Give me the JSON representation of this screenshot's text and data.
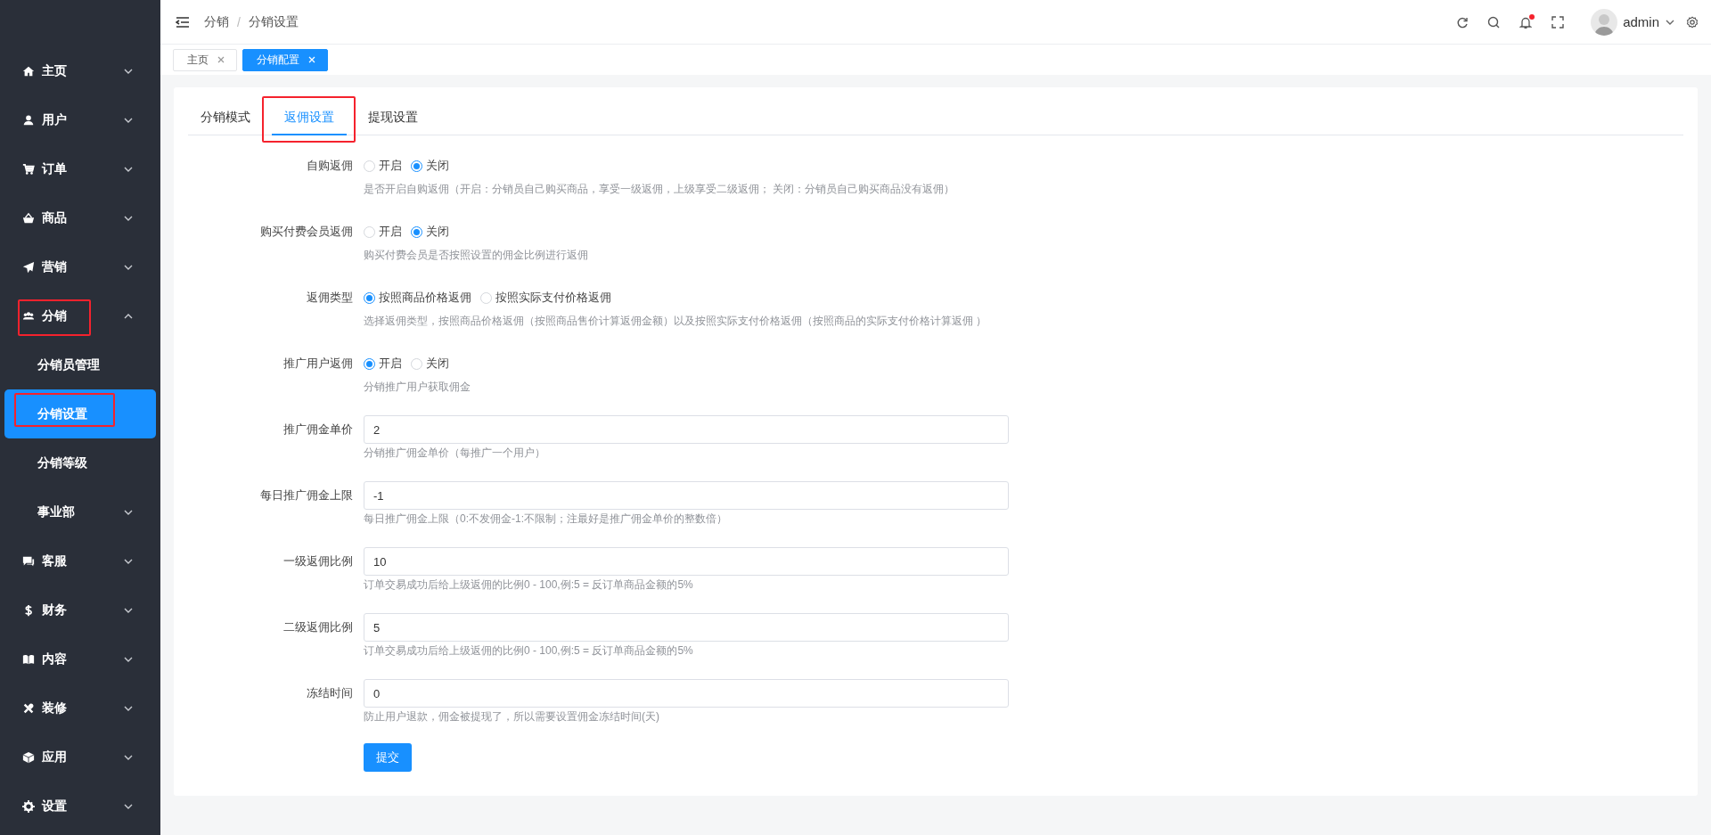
{
  "sidebar": {
    "items": [
      {
        "label": "主页",
        "expanded": false,
        "selected": false,
        "highlighted": false
      },
      {
        "label": "用户",
        "expanded": false,
        "selected": false,
        "highlighted": false
      },
      {
        "label": "订单",
        "expanded": false,
        "selected": false,
        "highlighted": false
      },
      {
        "label": "商品",
        "expanded": false,
        "selected": false,
        "highlighted": false
      },
      {
        "label": "营销",
        "expanded": false,
        "selected": false,
        "highlighted": false
      },
      {
        "label": "分销",
        "expanded": true,
        "selected": false,
        "highlighted": true,
        "children": [
          {
            "label": "分销员管理",
            "selected": false,
            "highlighted": false
          },
          {
            "label": "分销设置",
            "selected": true,
            "highlighted": true
          },
          {
            "label": "分销等级",
            "selected": false,
            "highlighted": false
          },
          {
            "label": "事业部",
            "expanded": false,
            "selected": false,
            "highlighted": false
          }
        ]
      },
      {
        "label": "客服",
        "expanded": false,
        "selected": false,
        "highlighted": false
      },
      {
        "label": "财务",
        "expanded": false,
        "selected": false,
        "highlighted": false
      },
      {
        "label": "内容",
        "expanded": false,
        "selected": false,
        "highlighted": false
      },
      {
        "label": "装修",
        "expanded": false,
        "selected": false,
        "highlighted": false
      },
      {
        "label": "应用",
        "expanded": false,
        "selected": false,
        "highlighted": false
      },
      {
        "label": "设置",
        "expanded": false,
        "selected": false,
        "highlighted": false
      }
    ]
  },
  "header": {
    "breadcrumb": [
      "分销",
      "分销设置"
    ],
    "breadcrumb_separator": "/",
    "has_notification": true,
    "user": "admin"
  },
  "tags": [
    {
      "label": "主页",
      "selected": false
    },
    {
      "label": "分销配置",
      "selected": true
    }
  ],
  "tabs": [
    {
      "label": "分销模式",
      "selected": false,
      "highlighted": false
    },
    {
      "label": "返佣设置",
      "selected": true,
      "highlighted": true
    },
    {
      "label": "提现设置",
      "selected": false,
      "highlighted": false
    }
  ],
  "form": [
    {
      "kind": "radio",
      "label": "自购返佣",
      "options": [
        {
          "label": "开启",
          "selected": false
        },
        {
          "label": "关闭",
          "selected": true
        }
      ],
      "help": "是否开启自购返佣（开启：分销员自己购买商品，享受一级返佣，上级享受二级返佣； 关闭：分销员自己购买商品没有返佣）"
    },
    {
      "kind": "radio",
      "label": "购买付费会员返佣",
      "options": [
        {
          "label": "开启",
          "selected": false
        },
        {
          "label": "关闭",
          "selected": true
        }
      ],
      "help": "购买付费会员是否按照设置的佣金比例进行返佣"
    },
    {
      "kind": "radio",
      "label": "返佣类型",
      "options": [
        {
          "label": "按照商品价格返佣",
          "selected": true
        },
        {
          "label": "按照实际支付价格返佣",
          "selected": false
        }
      ],
      "help": "选择返佣类型，按照商品价格返佣（按照商品售价计算返佣金额）以及按照实际支付价格返佣（按照商品的实际支付价格计算返佣 ）"
    },
    {
      "kind": "radio",
      "label": "推广用户返佣",
      "options": [
        {
          "label": "开启",
          "selected": true
        },
        {
          "label": "关闭",
          "selected": false
        }
      ],
      "help": "分销推广用户获取佣金"
    },
    {
      "kind": "input",
      "label": "推广佣金单价",
      "value": "2",
      "help": "分销推广佣金单价（每推广一个用户）"
    },
    {
      "kind": "input",
      "label": "每日推广佣金上限",
      "value": "-1",
      "help": "每日推广佣金上限（0:不发佣金-1:不限制；注最好是推广佣金单价的整数倍）"
    },
    {
      "kind": "input",
      "label": "一级返佣比例",
      "value": "10",
      "help": "订单交易成功后给上级返佣的比例0 - 100,例:5 = 反订单商品金额的5%"
    },
    {
      "kind": "input",
      "label": "二级返佣比例",
      "value": "5",
      "help": "订单交易成功后给上级返佣的比例0 - 100,例:5 = 反订单商品金额的5%"
    },
    {
      "kind": "input",
      "label": "冻结时间",
      "value": "0",
      "help": "防止用户退款，佣金被提现了，所以需要设置佣金冻结时间(天)"
    }
  ],
  "submit": "提交"
}
